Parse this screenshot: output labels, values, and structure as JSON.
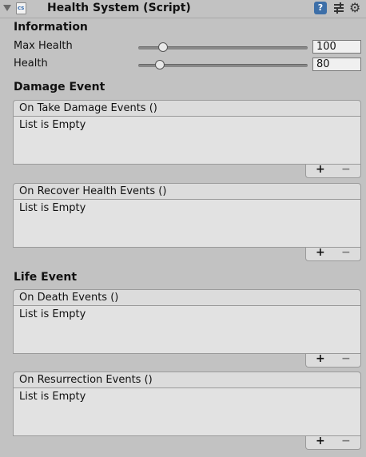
{
  "header": {
    "title": "Health System (Script)",
    "icons": [
      "foldout-arrow-icon",
      "cs-script-icon",
      "help-icon",
      "preset-icon",
      "gear-icon"
    ],
    "help_glyph": "?"
  },
  "information": {
    "heading": "Information",
    "max_health": {
      "label": "Max Health",
      "value": "100",
      "slider_fraction": 0.12
    },
    "health": {
      "label": "Health",
      "value": "80",
      "slider_fraction": 0.1
    }
  },
  "damage_event": {
    "heading": "Damage Event",
    "take_damage": {
      "title": "On Take Damage Events ()",
      "body": "List is Empty"
    },
    "recover_health": {
      "title": "On Recover Health Events ()",
      "body": "List is Empty"
    }
  },
  "life_event": {
    "heading": "Life Event",
    "death": {
      "title": "On Death Events ()",
      "body": "List is Empty"
    },
    "resurrection": {
      "title": "On Resurrection Events ()",
      "body": "List is Empty"
    }
  },
  "list_controls": {
    "add": "+",
    "remove": "−"
  }
}
